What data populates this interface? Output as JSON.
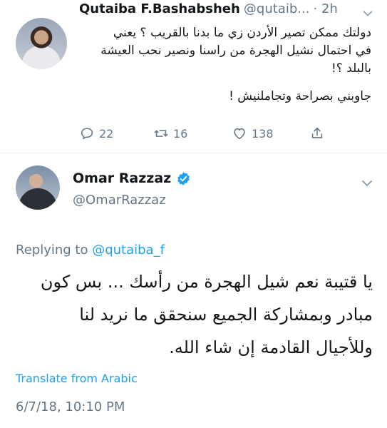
{
  "tweet1": {
    "display_name": "Qutaiba F.Bashabsheh",
    "handle": "@qutaib...",
    "time": "· 2h",
    "text_lines": [
      "دولتك ممكن تصير الأردن زي ما بدنا بالقريب ؟ يعني",
      "في احتمال نشيل الهجرة من راسنا ونصير نحب العيشة",
      "بالبلد ؟!",
      "جاوبني بصراحة وتجاملنيش !"
    ],
    "replies": "22",
    "retweets": "16",
    "likes": "138",
    "icons": [
      "reply-icon",
      "retweet-icon",
      "like-icon",
      "share-icon",
      "chevron-down-icon"
    ]
  },
  "tweet2": {
    "display_name": "Omar Razzaz",
    "handle": "@OmarRazzaz",
    "replying_prefix": "Replying to ",
    "replying_mention": "@qutaiba_f",
    "text_lines": [
      "يا قتيبة نعم شيل الهجرة من رأسك ... بس كون",
      "مبادر  وبمشاركة الجميع سنحقق ما نريد لنا",
      "وللأجيال القادمة إن شاء الله."
    ],
    "translate": "Translate from Arabic",
    "timestamp": "6/7/18, 10:10 PM",
    "icons": [
      "verified-badge-icon",
      "chevron-down-icon"
    ]
  },
  "colors": {
    "link": "#1da1f2",
    "secondary_text": "#657786",
    "primary_text": "#14171a",
    "divider": "#e6ecf0"
  }
}
